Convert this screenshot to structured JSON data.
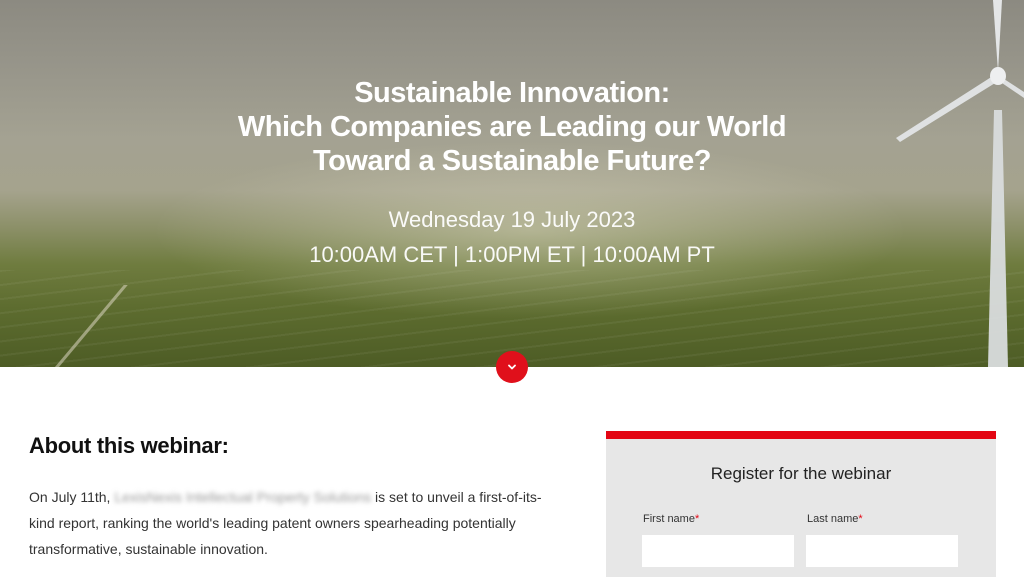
{
  "hero": {
    "title_lines": [
      "Sustainable Innovation:",
      "Which Companies are Leading our World",
      "Toward a Sustainable Future?"
    ],
    "date": "Wednesday 19 July 2023",
    "times": "10:00AM CET | 1:00PM ET | 10:00AM PT",
    "scroll_icon": "chevron-down-icon"
  },
  "about": {
    "heading": "About this webinar:",
    "text_before": "On July 11th, ",
    "blurred_company": "LexisNexis Intellectual Property Solutions",
    "text_after": " is set to unveil a first-of-its-kind report, ranking the world's leading patent owners spearheading potentially transformative, sustainable innovation."
  },
  "register": {
    "title": "Register for the webinar",
    "first_name_label": "First name",
    "last_name_label": "Last name",
    "required_mark": "*",
    "first_name_value": "",
    "last_name_value": ""
  },
  "colors": {
    "accent": "#e30613",
    "card_bg": "#e7e7e7"
  }
}
